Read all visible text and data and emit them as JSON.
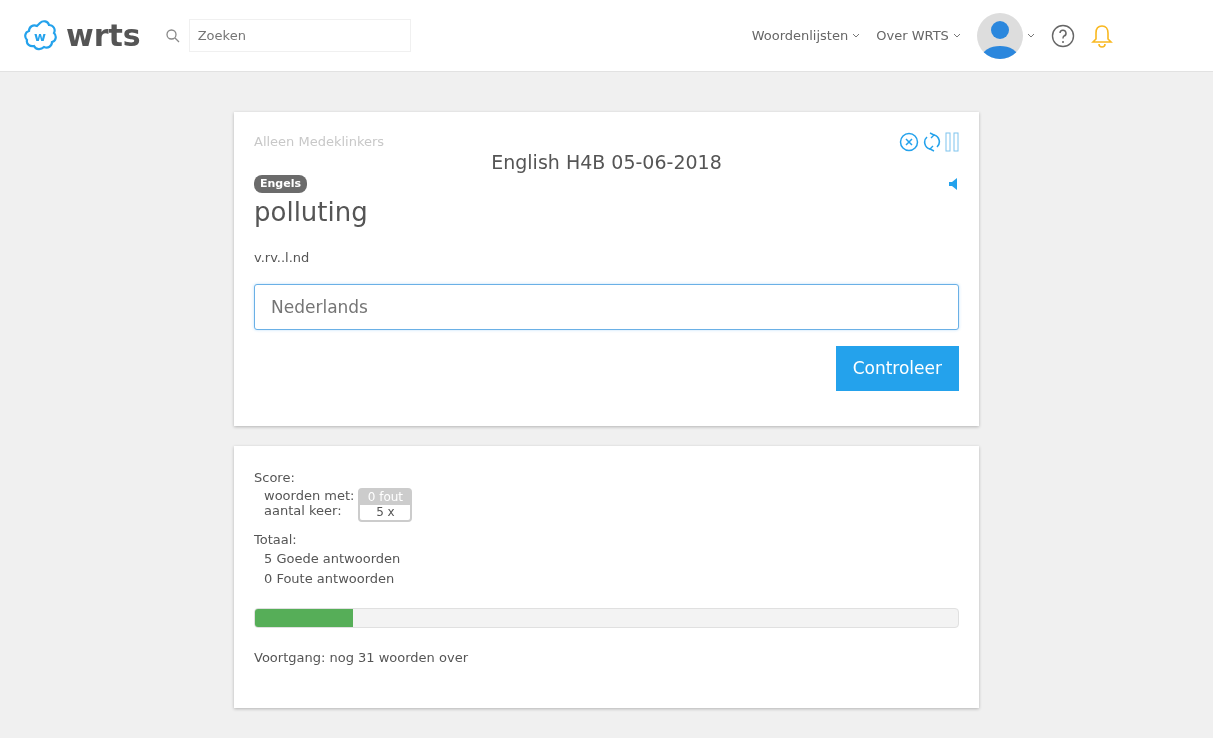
{
  "header": {
    "logo_mark": "w",
    "logo": "wrts",
    "search": {
      "placeholder": "Zoeken"
    },
    "menus": [
      "Woordenlijsten",
      "Over WRTS"
    ]
  },
  "quiz": {
    "mode": "Alleen Medeklinkers",
    "title": "English H4B 05-06-2018",
    "language": "Engels",
    "word": "polluting",
    "hint": "v.rv..l.nd",
    "answer": {
      "placeholder": "Nederlands"
    },
    "check_button": "Controleer"
  },
  "score": {
    "heading": "Score:",
    "rows": [
      {
        "label": "woorden met:",
        "value": "0 fout",
        "selected": true
      },
      {
        "label": "aantal keer:",
        "value": "5 x",
        "selected": false
      }
    ],
    "total_heading": "Totaal:",
    "totals": [
      "5 Goede antwoorden",
      "0 Foute antwoorden"
    ],
    "progress": {
      "level": 0.14
    },
    "progress_text": "Voortgang: nog 31 woorden over"
  }
}
